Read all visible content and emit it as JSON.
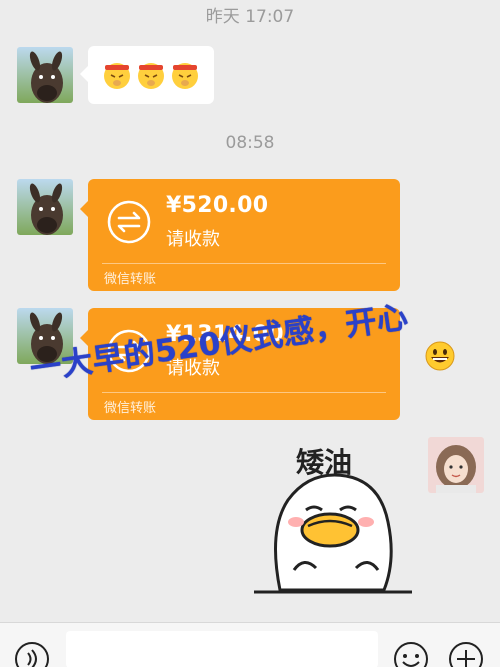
{
  "chat": {
    "timestamp_1": "昨天 17:07",
    "timestamp_2": "08:58"
  },
  "messages": [
    {
      "type": "emoji",
      "sender": "friend",
      "emoji_icons": [
        "pray-face-emoji",
        "pray-face-emoji",
        "pray-face-emoji"
      ]
    },
    {
      "type": "transfer",
      "sender": "friend",
      "amount": "¥520.00",
      "status": "请收款",
      "label": "微信转账"
    },
    {
      "type": "transfer",
      "sender": "friend",
      "amount": "¥1314.00",
      "status": "请收款",
      "label": "微信转账"
    },
    {
      "type": "sticker",
      "sender": "me",
      "sticker_text": "矮油"
    }
  ],
  "overlay": {
    "caption": "一大早的520仪式感，开心",
    "emoji_icon": "grinning-face-emoji"
  },
  "bottombar": {
    "icons": [
      "voice-icon",
      "emoji-icon",
      "plus-icon"
    ]
  },
  "colors": {
    "background": "#ececec",
    "transfer_orange": "#fb9c1c",
    "caption_blue": "#2a41c9"
  }
}
